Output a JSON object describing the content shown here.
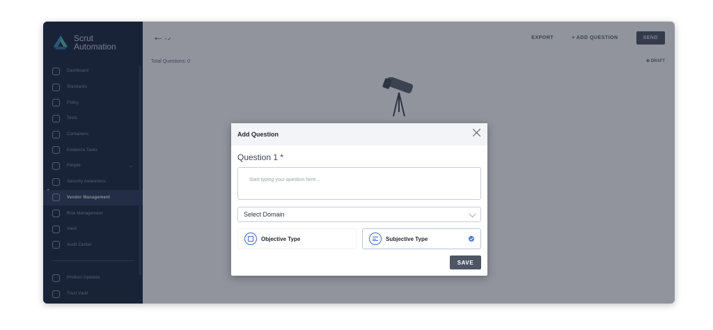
{
  "sidebar": {
    "brand": {
      "line1": "Scrut",
      "line2": "Automation"
    },
    "items": [
      {
        "label": "Dashboard",
        "icon": "dashboard-icon"
      },
      {
        "label": "Standards",
        "icon": "standards-icon"
      },
      {
        "label": "Policy",
        "icon": "policy-icon"
      },
      {
        "label": "Tests",
        "icon": "tests-icon"
      },
      {
        "label": "Containers",
        "icon": "containers-icon"
      },
      {
        "label": "Evidence Tasks",
        "icon": "evidence-icon"
      },
      {
        "label": "People",
        "icon": "people-icon",
        "has_chevron": true
      },
      {
        "label": "Security Awareness",
        "icon": "security-icon"
      },
      {
        "label": "Vendor Management",
        "icon": "vendor-icon",
        "active": true
      },
      {
        "label": "Risk Management",
        "icon": "risk-icon"
      },
      {
        "label": "Vault",
        "icon": "vault-icon"
      },
      {
        "label": "Audit Center",
        "icon": "audit-icon"
      }
    ],
    "bottom_items": [
      {
        "label": "Product Updates",
        "icon": "megaphone-icon"
      },
      {
        "label": "Trust Vault",
        "icon": "trust-vault-icon"
      }
    ],
    "chevron": "⌄"
  },
  "topbar": {
    "back_symbol": "←",
    "back_sub": "• ✔",
    "export_label": "EXPORT",
    "add_question_label": "+ ADD QUESTION",
    "send_label": "SEND"
  },
  "main": {
    "total_questions": "Total Questions: 0",
    "draft_label": "⊕ DRAFT"
  },
  "modal": {
    "title": "Add Question",
    "question_label": "Question 1 *",
    "question_placeholder": "Start typing your question here...",
    "question_value": "",
    "domain_select": "Select Domain",
    "types": [
      {
        "label": "Objective Type",
        "icon": "objective-type-icon",
        "selected": false
      },
      {
        "label": "Subjective Type",
        "icon": "subjective-type-icon",
        "selected": true
      }
    ],
    "save_label": "SAVE"
  },
  "colors": {
    "sidebar_bg": "#16233d",
    "accent": "#3c64c4",
    "save_bg": "#4e5563"
  }
}
